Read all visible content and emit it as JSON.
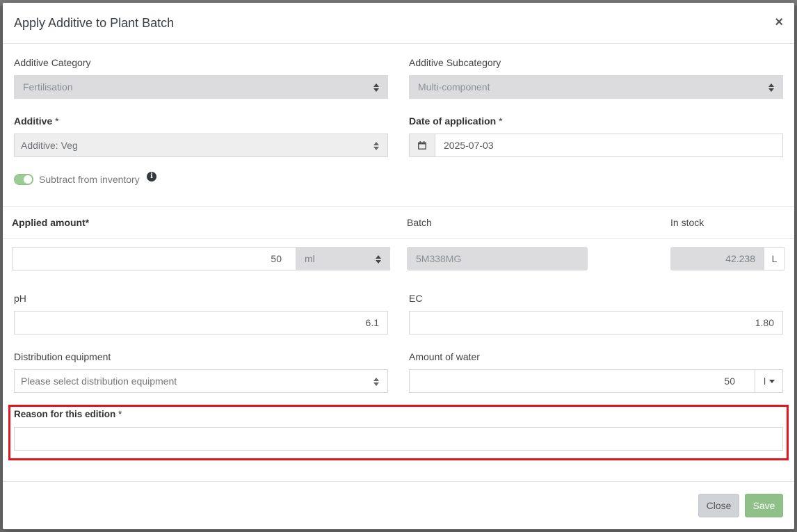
{
  "modal": {
    "title": "Apply Additive to Plant Batch",
    "close_glyph": "×"
  },
  "form": {
    "category": {
      "label": "Additive Category",
      "value": "Fertilisation"
    },
    "subcategory": {
      "label": "Additive Subcategory",
      "value": "Multi-component"
    },
    "additive": {
      "label": "Additive",
      "required_mark": "*",
      "value": "Additive: Veg"
    },
    "date": {
      "label": "Date of application",
      "required_mark": "*",
      "value": "2025-07-03",
      "icon": "calendar-icon"
    },
    "subtract_inventory": {
      "label": "Subtract from inventory",
      "enabled": true,
      "info_glyph": "i"
    },
    "applied_amount": {
      "label": "Applied amount*",
      "value": "50",
      "unit": "ml"
    },
    "batch": {
      "label": "Batch",
      "value": "5M338MG"
    },
    "in_stock": {
      "label": "In stock",
      "value": "42.238",
      "unit": "L"
    },
    "ph": {
      "label": "pH",
      "value": "6.1"
    },
    "ec": {
      "label": "EC",
      "value": "1.80"
    },
    "distribution": {
      "label": "Distribution equipment",
      "placeholder": "Please select distribution equipment"
    },
    "water": {
      "label": "Amount of water",
      "value": "50",
      "unit": "l"
    },
    "reason": {
      "label": "Reason for this edition",
      "required_mark": "*",
      "value": ""
    }
  },
  "footer": {
    "close_label": "Close",
    "save_label": "Save"
  },
  "colors": {
    "highlight": "#e3141b",
    "save": "#8fc088",
    "toggle": "#9ccc95"
  }
}
